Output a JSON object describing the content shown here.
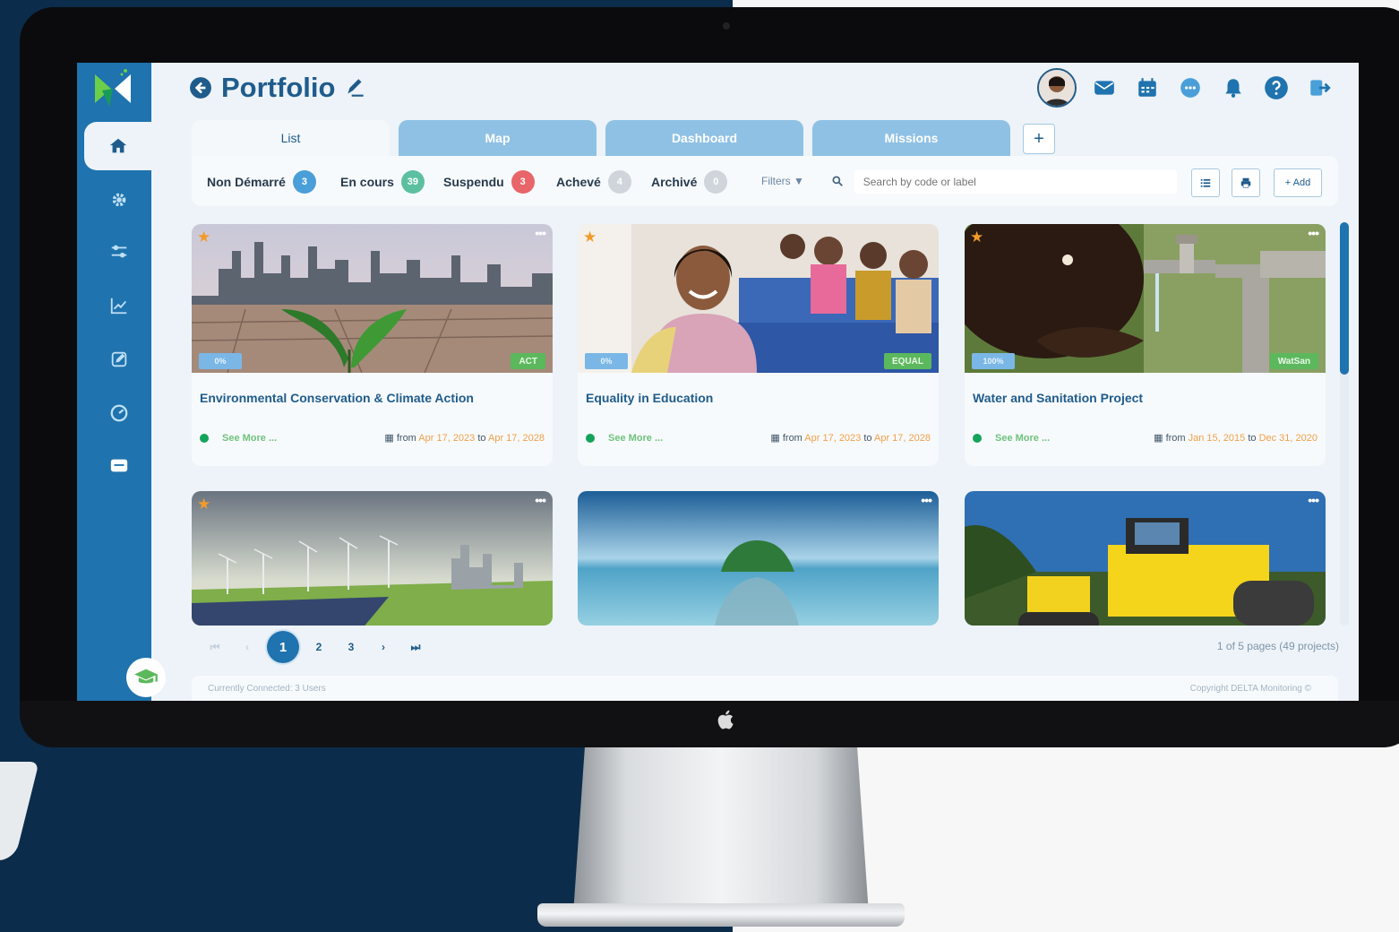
{
  "app": {
    "page_title": "Portfolio",
    "accent": "#1f73ae",
    "icons": [
      "back-arrow-icon",
      "edit-pen-icon"
    ]
  },
  "header_icons": [
    "user-avatar",
    "mail-icon",
    "calendar-icon",
    "chat-icon",
    "bell-icon",
    "help-icon",
    "logout-icon"
  ],
  "sidebar": {
    "items": [
      {
        "name": "home",
        "icon": "home-icon",
        "active": true
      },
      {
        "name": "settings",
        "icon": "gear-icon"
      },
      {
        "name": "filters",
        "icon": "sliders-icon"
      },
      {
        "name": "analytics",
        "icon": "trend-chart-icon"
      },
      {
        "name": "edit",
        "icon": "pencil-icon"
      },
      {
        "name": "performance",
        "icon": "gauge-icon"
      },
      {
        "name": "documents",
        "icon": "folder-icon"
      }
    ],
    "bottom_icon": "graduation-cap-icon"
  },
  "tabs": [
    {
      "label": "List",
      "active": true
    },
    {
      "label": "Map"
    },
    {
      "label": "Dashboard"
    },
    {
      "label": "Missions"
    }
  ],
  "tab_add_label": "+",
  "statuses": [
    {
      "label": "Non Démarré",
      "count": "3",
      "color": "#4a9fd8"
    },
    {
      "label": "En cours",
      "count": "39",
      "color": "#5cc0a0"
    },
    {
      "label": "Suspendu",
      "count": "3",
      "color": "#e8656a"
    },
    {
      "label": "Achevé",
      "count": "4",
      "color": "#cfd5da"
    },
    {
      "label": "Archivé",
      "count": "0",
      "color": "#cfd5da"
    }
  ],
  "filters_label": "Filters",
  "search": {
    "placeholder": "Search by code or label"
  },
  "toolbar": {
    "add_label": "+ Add"
  },
  "projects": [
    {
      "title": "Environmental Conservation & Climate Action",
      "progress": "0%",
      "tag": "ACT",
      "see_more": "See More ...",
      "from_label": "from",
      "start": "Apr 17, 2023",
      "to_label": "to",
      "end": "Apr 17, 2028"
    },
    {
      "title": "Equality in Education",
      "progress": "0%",
      "tag": "EQUAL",
      "see_more": "See More ...",
      "from_label": "from",
      "start": "Apr 17, 2023",
      "to_label": "to",
      "end": "Apr 17, 2028"
    },
    {
      "title": "Water and Sanitation Project",
      "progress": "100%",
      "tag": "WatSan",
      "see_more": "See More ...",
      "from_label": "from",
      "start": "Jan 15, 2015",
      "to_label": "to",
      "end": "Dec 31, 2020"
    }
  ],
  "pagination": {
    "pages": [
      "1",
      "2",
      "3"
    ],
    "current": "1",
    "info": "1 of 5 pages (49 projects)"
  },
  "footer": {
    "connected": "Currently Connected: 3 Users",
    "copyright": "Copyright DELTA Monitoring ©"
  }
}
